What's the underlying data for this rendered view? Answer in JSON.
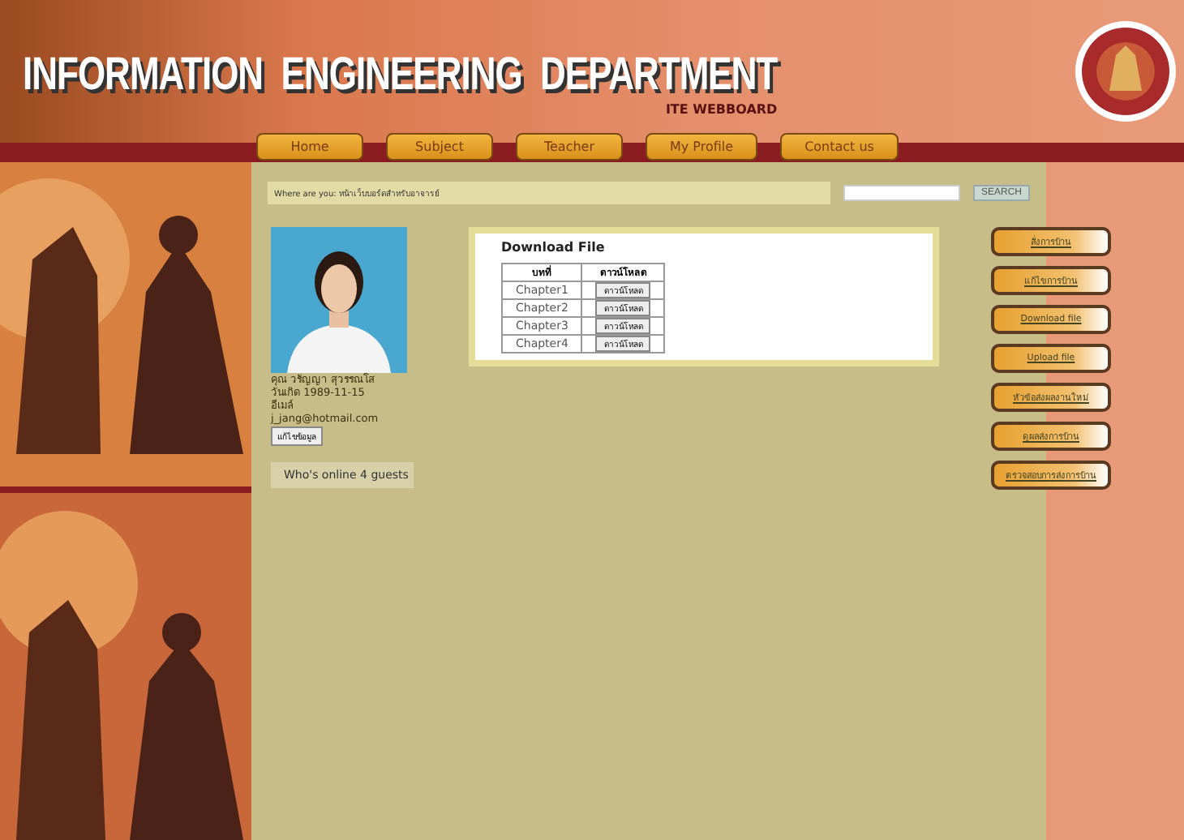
{
  "header": {
    "title": "INFORMATION  ENGINEERING  DEPARTMENT",
    "subtitle": "ITE WEBBOARD"
  },
  "nav": [
    "Home",
    "Subject",
    "Teacher",
    "My Profile",
    "Contact us"
  ],
  "breadcrumb": "Where are you: หน้าเว็บบอร์ดสำหรับอาจารย์",
  "search": {
    "button": "SEARCH"
  },
  "profile": {
    "lines": [
      "คุณ วรัญญา สุวรรณโส",
      "วันเกิด 1989-11-15",
      "อีเมล์",
      "j_jang@hotmail.com"
    ],
    "edit_button": "แก้ไขข้อมูล"
  },
  "online": "Who's online 4 guests",
  "download": {
    "title": "Download File",
    "columns": [
      "บทที่",
      "ดาวน์โหลด"
    ],
    "rows": [
      {
        "chapter": "Chapter1",
        "button": "ดาวน์โหลด"
      },
      {
        "chapter": "Chapter2",
        "button": "ดาวน์โหลด"
      },
      {
        "chapter": "Chapter3",
        "button": "ดาวน์โหลด"
      },
      {
        "chapter": "Chapter4",
        "button": "ดาวน์โหลด"
      }
    ]
  },
  "side_menu": [
    "สั่งการบ้าน",
    "แก้ไขการบ้าน",
    "Download file",
    "Upload file",
    "หัวข้อส่งผลงานใหม่",
    "ดูผลส่งการบ้าน",
    "ตรวจสอบการส่งการบ้าน"
  ]
}
